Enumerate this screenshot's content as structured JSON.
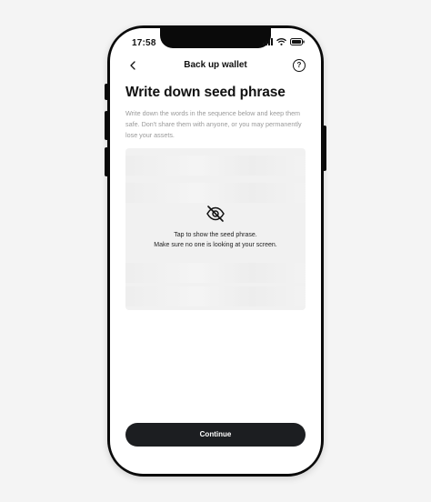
{
  "status_bar": {
    "time": "17:58",
    "icons": [
      "cellular-signal-icon",
      "wifi-icon",
      "battery-icon"
    ]
  },
  "nav": {
    "title": "Back up wallet",
    "back_icon": "chevron-left-icon",
    "help_icon": "question-circle-icon",
    "help_glyph": "?"
  },
  "main": {
    "title": "Write down seed phrase",
    "description": "Write down the words in the sequence below and keep them safe. Don't share them with anyone, or you may permanently lose your assets.",
    "seed_area": {
      "icon": "eye-off-icon",
      "line1": "Tap to show the seed phrase.",
      "line2": "Make sure no one is looking at your screen."
    }
  },
  "actions": {
    "continue_label": "Continue"
  },
  "colors": {
    "button_bg": "#1c1e21",
    "description_text": "#9a9a9a",
    "seed_bg": "#f1f1f1"
  }
}
